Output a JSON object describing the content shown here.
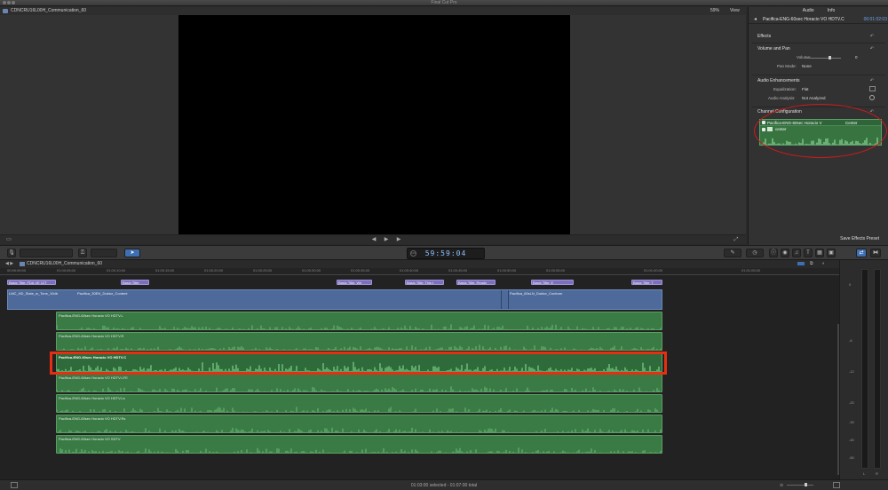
{
  "app": {
    "title": "Final Cut Pro"
  },
  "viewer": {
    "project_name": "CDNCRU16L00H_Communication_60",
    "zoom": "59%",
    "view_label": "View"
  },
  "inspector": {
    "tabs": [
      "Audio",
      "Info"
    ],
    "clip_name": "Pacifica-ENG-60sec Horacio VO HDTV.C",
    "clip_timecode": "00:01:02:03",
    "sections": {
      "effects": "Effects",
      "volume_pan": "Volume and Pan",
      "volume_label": "Volume:",
      "volume_value": "0",
      "pan_mode_label": "Pan Mode:",
      "pan_mode_value": "None",
      "audio_enh": "Audio Enhancements",
      "eq_label": "Equalization:",
      "eq_value": "Flat",
      "analysis_label": "Audio Analysis:",
      "analysis_value": "Not Analyzed",
      "channel_config": "Channel Configuration",
      "channel_clip": "Pacifica-ENG-60sec Horacio V",
      "channel_mode": "Center",
      "channel_sub": "center"
    },
    "save_preset": "Save Effects Preset",
    "reset_icon": "reset-arrow-icon"
  },
  "toolbar": {
    "timecode": "59:59:04"
  },
  "timeline": {
    "project_name": "CDNCRU16L00H_Communication_60",
    "ruler_ticks": [
      "00:59:55:00",
      "01:00:05:00",
      "01:00:10:00",
      "01:00:15:00",
      "01:00:20:00",
      "01:00:25:00",
      "01:00:30:00",
      "01:00:35:00",
      "01:00:40:00",
      "01:00:45:00",
      "01:00:50:00",
      "01:00:55:00",
      "01:01:00:00",
      "01:01:05:00"
    ],
    "titles": [
      "Basic Title: FDA VE 12T",
      "Basic Title:",
      "Basic Title: We",
      "Basic Title: This t",
      "Basic Title: Ready",
      "Basic Title: E",
      "Basic Title: T"
    ],
    "video_clips": [
      "LMC_HD_Slate_w_Tone_10db",
      "Pacifica_30EN_Doktor_Content",
      "Pacifica_60sLN_Doktor_Conform"
    ],
    "audio_clips": [
      "Pacifica-ENG-60sec Horacio VO HDTV.L",
      "Pacifica-ENG-60sec Horacio VO HDTV.R",
      "Pacifica-ENG-60sec Horacio VO HDTV.C",
      "Pacifica-ENG-60sec Horacio VO HDTV.LFE",
      "Pacifica-ENG-60sec Horacio VO HDTV.Ls",
      "Pacifica-ENG-60sec Horacio VO HDTV.Rs",
      "Pacifica-ENG-60sec Horacio VO SDTV"
    ],
    "selected_audio_index": 2
  },
  "meters": {
    "labels": [
      "0",
      "-6",
      "-12",
      "-20",
      "-30",
      "-40",
      "-50"
    ],
    "channels": [
      "L",
      "R"
    ]
  },
  "status": {
    "text": "01:03:00 selected - 01:07:00 total"
  },
  "colors": {
    "audio_clip": "#3a7a45",
    "title_clip": "#7d6fbc",
    "video_clip": "#4d6a9a",
    "highlight": "#e62e12",
    "timecode": "#8ec1ff"
  }
}
